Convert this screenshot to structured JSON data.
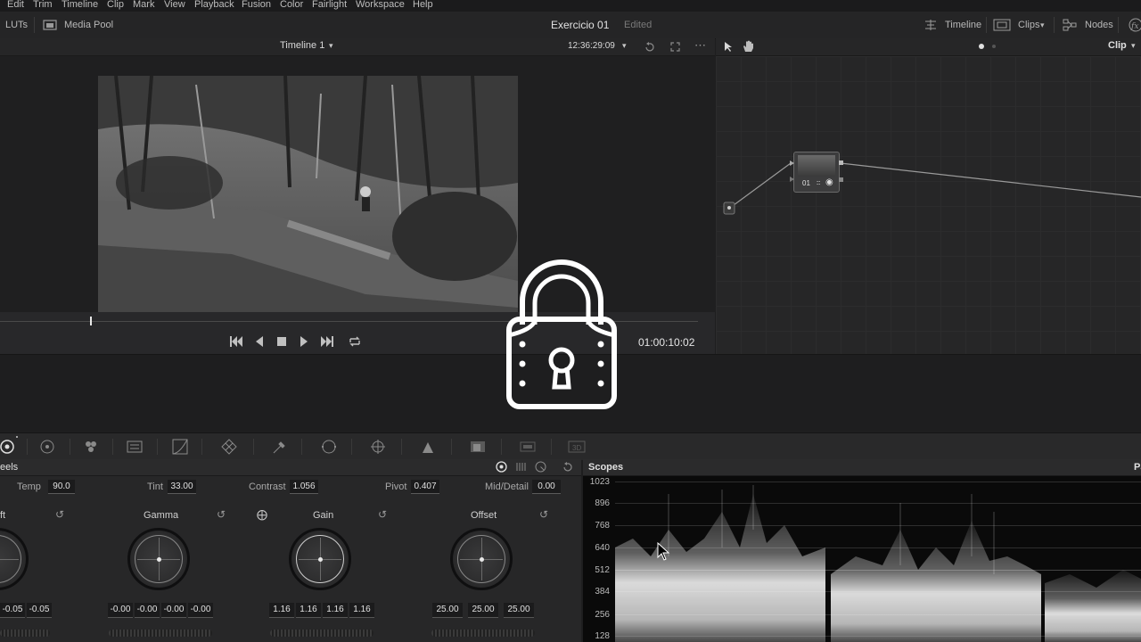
{
  "menu": [
    "Edit",
    "Trim",
    "Timeline",
    "Clip",
    "Mark",
    "View",
    "Playback",
    "Fusion",
    "Color",
    "Fairlight",
    "Workspace",
    "Help"
  ],
  "toolbar": {
    "luts": "LUTs",
    "media_pool": "Media Pool",
    "project_title": "Exercicio 01",
    "project_status": "Edited",
    "timeline": "Timeline",
    "clips": "Clips",
    "nodes": "Nodes"
  },
  "viewer": {
    "timeline_name": "Timeline 1",
    "timecode": "12:36:29:09",
    "clip_label": "Clip",
    "current_timecode": "01:00:10:02"
  },
  "node": {
    "label": "01"
  },
  "wheels": {
    "title": "eels",
    "temp_label": "Temp",
    "temp": "90.0",
    "tint_label": "Tint",
    "tint": "33.00",
    "contrast_label": "Contrast",
    "contrast": "1.056",
    "pivot_label": "Pivot",
    "pivot": "0.407",
    "middetail_label": "Mid/Detail",
    "middetail": "0.00",
    "lift_title": "ft",
    "lift": [
      "-0.05",
      "-0.05"
    ],
    "gamma_title": "Gamma",
    "gamma": [
      "-0.00",
      "-0.00",
      "-0.00",
      "-0.00"
    ],
    "gain_title": "Gain",
    "gain": [
      "1.16",
      "1.16",
      "1.16",
      "1.16"
    ],
    "offset_title": "Offset",
    "offset": [
      "25.00",
      "25.00",
      "25.00"
    ]
  },
  "scopes": {
    "title": "Scopes",
    "right_label": "Pa",
    "ticks": [
      "1023",
      "896",
      "768",
      "640",
      "512",
      "384",
      "256",
      "128"
    ]
  },
  "colors": {
    "background": "#1e1e1f",
    "panel": "#262627",
    "lock_overlay": "#ffffff"
  }
}
